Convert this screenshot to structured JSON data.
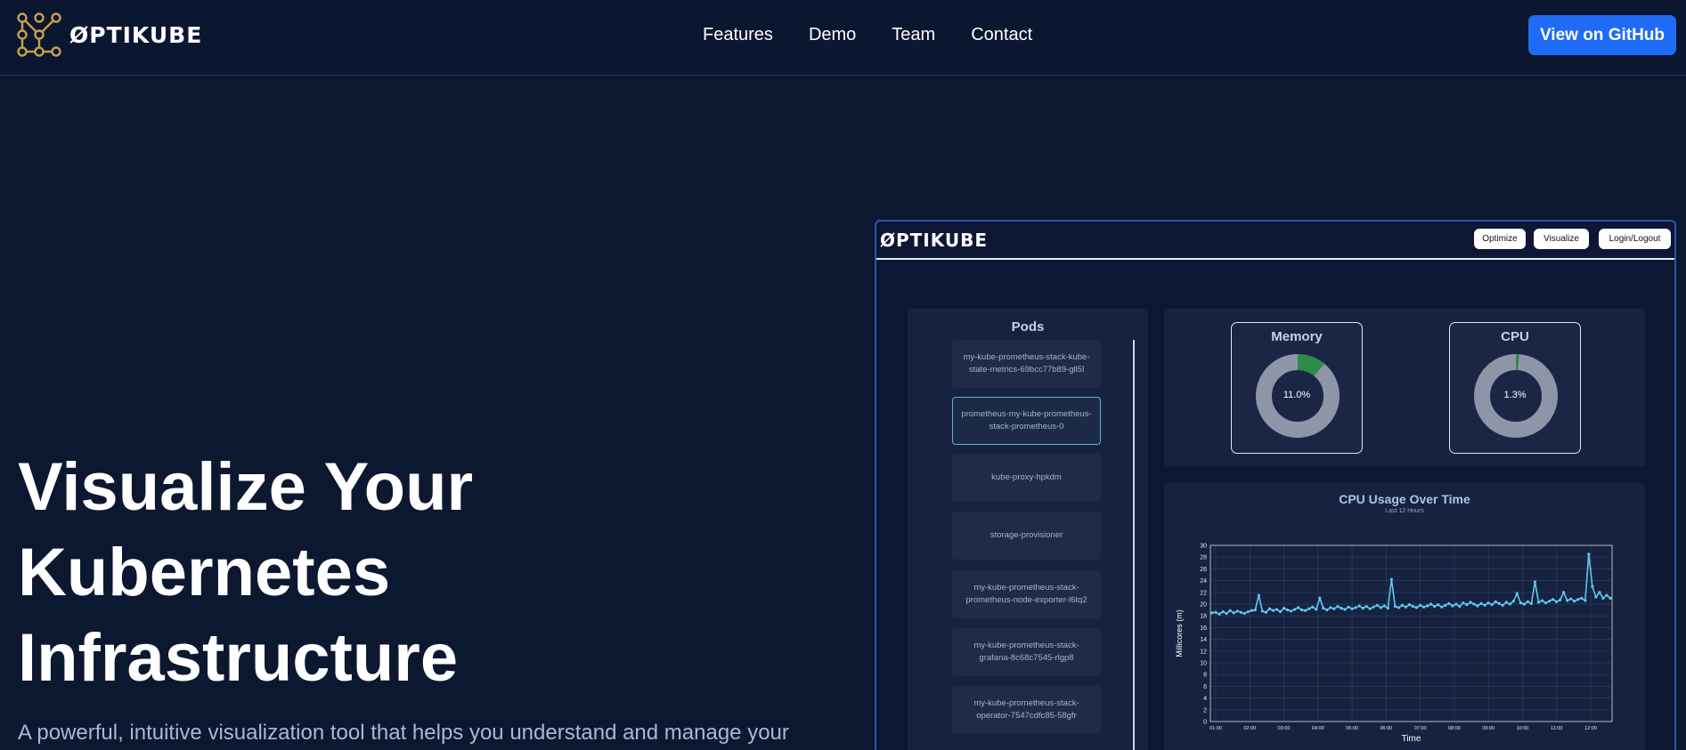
{
  "nav": {
    "brand": "ØPTIKUBE",
    "links": [
      "Features",
      "Demo",
      "Team",
      "Contact"
    ],
    "github_label": "View on GitHub"
  },
  "hero": {
    "title": "Visualize Your\nKubernetes\nInfrastructure",
    "subtitle": "A powerful, intuitive visualization tool that helps you understand and manage your"
  },
  "preview": {
    "brand": "ØPTIKUBE",
    "buttons": [
      "Optimize",
      "Visualize",
      "Login/Logout"
    ],
    "pods": {
      "title": "Pods",
      "items": [
        "my-kube-prometheus-stack-kube-state-metrics-69bcc77b89-gll5l",
        "prometheus-my-kube-prometheus-stack-prometheus-0",
        "kube-proxy-hpkdm",
        "storage-provisioner",
        "my-kube-prometheus-stack-prometheus-node-exporter-l6tq2",
        "my-kube-prometheus-stack-grafana-8c68c7545-rlgp8",
        "my-kube-prometheus-stack-operator-7547cdfc85-58gfr"
      ],
      "selected_index": 1
    },
    "gauges": [
      {
        "title": "Memory",
        "value_label": "11.0%",
        "fraction": 0.11,
        "color": "#2e8b4a"
      },
      {
        "title": "CPU",
        "value_label": "1.3%",
        "fraction": 0.013,
        "color": "#2e8b4a"
      }
    ]
  },
  "chart_data": {
    "type": "line",
    "title": "CPU Usage Over Time",
    "subtitle": "Last 12 Hours",
    "xlabel": "Time",
    "ylabel": "Millicores (m)",
    "ylim": [
      0,
      30
    ],
    "yticks": [
      0,
      2,
      4,
      6,
      8,
      10,
      12,
      14,
      16,
      18,
      20,
      22,
      24,
      26,
      28,
      30
    ],
    "xticks": [
      "01:00",
      "02:00",
      "03:00",
      "04:00",
      "05:00",
      "06:00",
      "07:00",
      "08:00",
      "09:00",
      "10:00",
      "11:00",
      "12:00"
    ],
    "grid": true,
    "line_color": "#5fc8f0",
    "series": [
      {
        "values": [
          18.5,
          18.6,
          18.3,
          18.7,
          18.4,
          18.9,
          18.5,
          18.8,
          18.6,
          18.4,
          18.7,
          18.9,
          19.0,
          21.5,
          18.8,
          18.6,
          19.2,
          18.9,
          19.1,
          18.7,
          19.3,
          19.0,
          18.8,
          19.1,
          19.4,
          19.0,
          18.9,
          19.2,
          19.5,
          19.1,
          21.0,
          19.3,
          19.0,
          19.4,
          19.2,
          19.6,
          19.3,
          19.1,
          19.5,
          19.2,
          19.4,
          19.7,
          19.3,
          19.6,
          19.2,
          19.5,
          19.8,
          19.4,
          19.7,
          19.3,
          24.2,
          19.6,
          19.4,
          19.8,
          19.5,
          19.9,
          19.6,
          19.4,
          19.8,
          19.5,
          19.7,
          20.0,
          19.6,
          19.9,
          19.5,
          19.8,
          20.1,
          19.7,
          20.0,
          19.6,
          20.2,
          19.9,
          20.3,
          20.0,
          19.7,
          20.1,
          19.8,
          20.2,
          19.9,
          20.4,
          20.1,
          19.8,
          20.3,
          20.0,
          20.5,
          21.8,
          20.2,
          20.0,
          20.4,
          20.1,
          23.8,
          20.3,
          20.6,
          20.2,
          20.5,
          20.8,
          20.4,
          20.7,
          22.0,
          20.6,
          20.9,
          20.5,
          20.8,
          21.0,
          20.6,
          28.5,
          23.0,
          21.2,
          22.0,
          21.0,
          21.5,
          21.0
        ]
      }
    ]
  }
}
